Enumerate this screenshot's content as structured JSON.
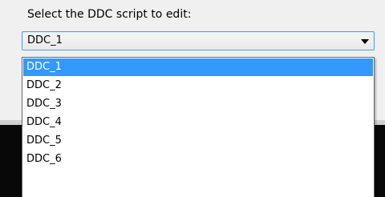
{
  "prompt": {
    "label": "Select the DDC script to edit:"
  },
  "combo": {
    "selected_value": "DDC_1",
    "arrow_icon": "chevron-down-icon"
  },
  "dropdown": {
    "options": [
      {
        "label": "DDC_1",
        "selected": true
      },
      {
        "label": "DDC_2",
        "selected": false
      },
      {
        "label": "DDC_3",
        "selected": false
      },
      {
        "label": "DDC_4",
        "selected": false
      },
      {
        "label": "DDC_5",
        "selected": false
      },
      {
        "label": "DDC_6",
        "selected": false
      }
    ]
  },
  "colors": {
    "highlight": "#3399ff",
    "combo_border": "#569de5"
  }
}
